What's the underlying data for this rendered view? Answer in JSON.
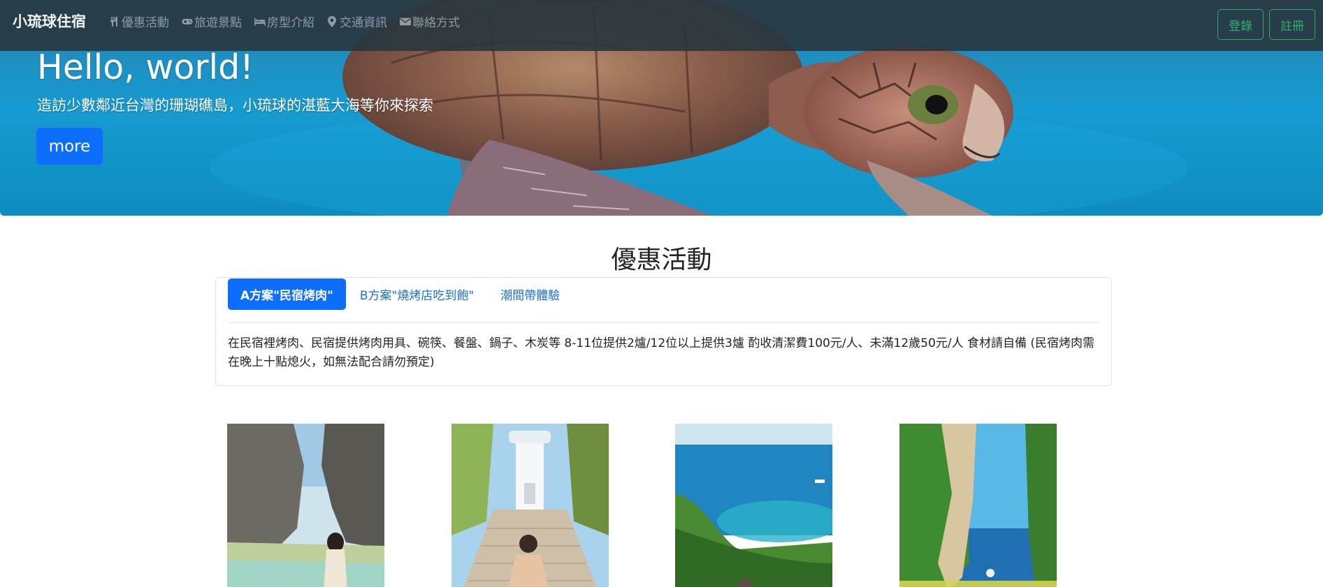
{
  "navbar": {
    "brand": "小琉球住宿",
    "links": [
      {
        "label": "優惠活動",
        "icon": "utensils-icon"
      },
      {
        "label": "旅遊景點",
        "icon": "gamepad-icon"
      },
      {
        "label": "房型介紹",
        "icon": "bed-icon"
      },
      {
        "label": "交通資訊",
        "icon": "map-marker-icon"
      },
      {
        "label": "聯絡方式",
        "icon": "envelope-icon"
      }
    ],
    "login_label": "登錄",
    "register_label": "註冊"
  },
  "hero": {
    "title": "Hello, world!",
    "subtitle": "造訪少數鄰近台灣的珊瑚礁島，小琉球的湛藍大海等你來探索",
    "button_label": "more"
  },
  "offers": {
    "title": "優惠活動",
    "tabs": [
      {
        "label": "A方案\"民宿烤肉\"",
        "active": true
      },
      {
        "label": "B方案\"燒烤店吃到飽\"",
        "active": false
      },
      {
        "label": "潮間帶體驗",
        "active": false
      }
    ],
    "content": "在民宿裡烤肉、民宿提供烤肉用具、碗筷、餐盤、鍋子、木炭等 8-11位提供2爐/12位以上提供3爐 酌收清潔費100元/人、未滿12歲50元/人 食材請自備 (民宿烤肉需在晚上十點熄火，如無法配合請勿預定)"
  },
  "colors": {
    "primary": "#0d6efd",
    "success": "#30b070",
    "navbar_bg": "#28363e"
  }
}
